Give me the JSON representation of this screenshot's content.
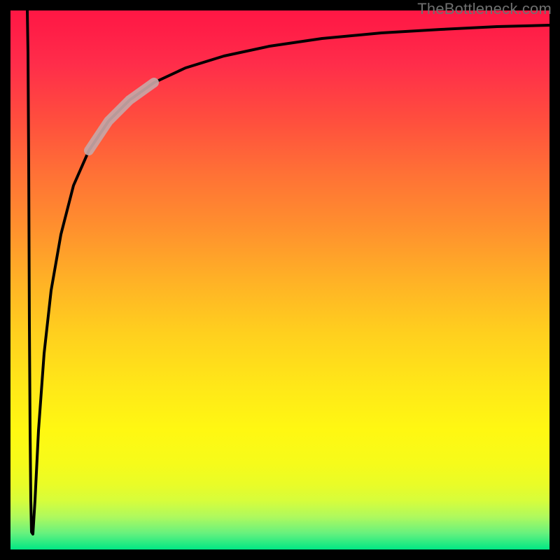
{
  "watermark": "TheBottleneck.com",
  "colors": {
    "frame": "#000000",
    "curve": "#000000",
    "highlight": "#c8a6a6",
    "gradient_top": "#ff1744",
    "gradient_bottom": "#00e784"
  },
  "chart_data": {
    "type": "line",
    "title": "",
    "xlabel": "",
    "ylabel": "",
    "xlim": [
      0,
      100
    ],
    "ylim": [
      0,
      100
    ],
    "x": [
      0,
      1,
      2,
      3,
      3.5,
      4,
      5,
      6,
      8,
      10,
      12,
      15,
      18,
      21,
      25,
      30,
      35,
      40,
      50,
      60,
      70,
      80,
      90,
      100
    ],
    "values": [
      100,
      50,
      10,
      2,
      0.5,
      5,
      20,
      35,
      50,
      60,
      67,
      74,
      78,
      81,
      84,
      87,
      89,
      90.5,
      92.5,
      94,
      95,
      95.8,
      96.3,
      96.7
    ],
    "annotations": [
      {
        "type": "highlight_segment",
        "x_start": 15,
        "x_end": 21
      }
    ]
  }
}
